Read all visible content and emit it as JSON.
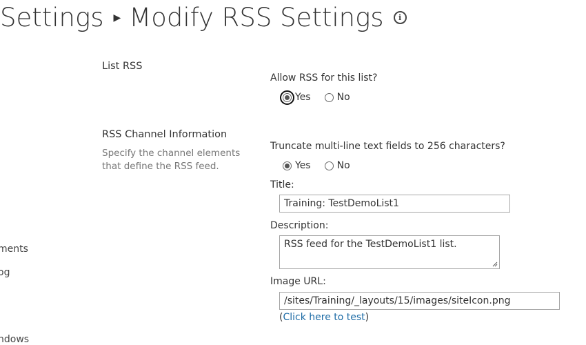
{
  "header": {
    "breadcrumb_parent": "Settings",
    "page_title": "Modify RSS Settings"
  },
  "leftnav": {
    "items": [
      "ments",
      "og",
      "ndows"
    ]
  },
  "list_rss": {
    "heading": "List RSS",
    "question": "Allow RSS for this list?",
    "yes_label": "Yes",
    "no_label": "No",
    "selected": "Yes"
  },
  "channel": {
    "heading": "RSS Channel Information",
    "description": "Specify the channel elements that define the RSS feed.",
    "truncate_question": "Truncate multi-line text fields to 256 characters?",
    "truncate_yes_label": "Yes",
    "truncate_no_label": "No",
    "truncate_selected": "Yes",
    "title_label": "Title:",
    "title_value": "Training: TestDemoList1",
    "description_label": "Description:",
    "description_value": "RSS feed for the TestDemoList1 list.",
    "image_url_label": "Image URL:",
    "image_url_value": "/sites/Training/_layouts/15/images/siteIcon.png",
    "test_link_open": "(",
    "test_link_text": "Click here to test",
    "test_link_close": ")"
  },
  "colors": {
    "link": "#1b6aa5",
    "text": "#333333",
    "muted": "#777777",
    "input_border": "#a6a6a6"
  }
}
